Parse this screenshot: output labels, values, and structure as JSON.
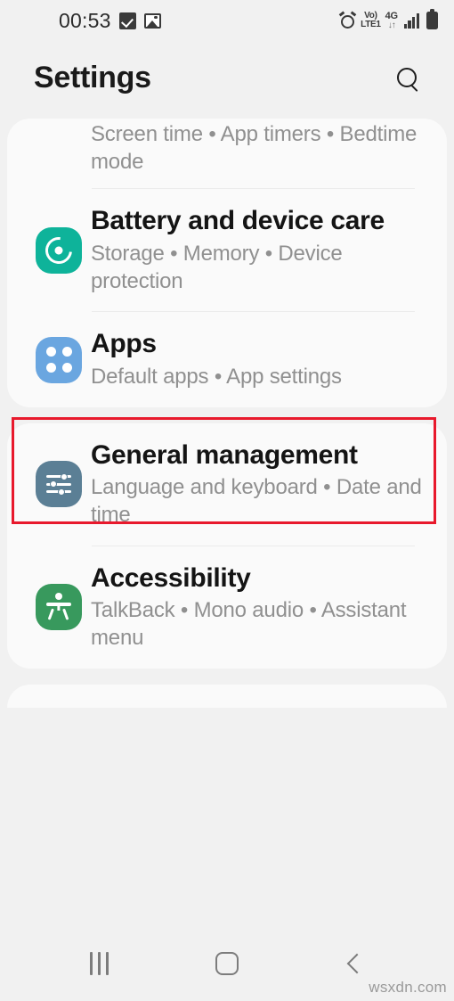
{
  "status_bar": {
    "time": "00:53",
    "left_icons": [
      "checkbox-filled-icon",
      "image-icon"
    ],
    "right_icons": [
      "alarm-icon",
      "volte-icon",
      "network-4g-icon",
      "signal-icon",
      "battery-icon"
    ],
    "volte_top": "Vo)",
    "volte_bottom": "LTE1",
    "network_type": "4G",
    "network_data_arrows": "↓↑"
  },
  "header": {
    "title": "Settings",
    "search_icon": "search-icon"
  },
  "cards": [
    {
      "id": "card-1",
      "rows": [
        {
          "id": "digital-wellbeing",
          "clipped": true,
          "title": "",
          "subtitle": "Screen time • App timers • Bedtime mode",
          "icon": "digital-wellbeing-icon",
          "icon_color": "#5e93c7",
          "highlighted": false
        },
        {
          "id": "battery-and-device-care",
          "clipped": false,
          "title": "Battery and device care",
          "subtitle": "Storage • Memory • Device protection",
          "icon": "battery-care-icon",
          "icon_color": "#0eb39a",
          "highlighted": false
        },
        {
          "id": "apps",
          "clipped": false,
          "title": "Apps",
          "subtitle": "Default apps • App settings",
          "icon": "apps-grid-icon",
          "icon_color": "#6aa6e0",
          "highlighted": true
        }
      ]
    },
    {
      "id": "card-2",
      "rows": [
        {
          "id": "general-management",
          "clipped": false,
          "title": "General management",
          "subtitle": "Language and keyboard • Date and time",
          "icon": "sliders-icon",
          "icon_color": "#5b7f95",
          "highlighted": false
        },
        {
          "id": "accessibility",
          "clipped": false,
          "title": "Accessibility",
          "subtitle": "TalkBack • Mono audio • Assistant menu",
          "icon": "accessibility-person-icon",
          "icon_color": "#38995d",
          "highlighted": false
        }
      ]
    }
  ],
  "highlight": {
    "target": "apps",
    "color": "#e8192c"
  },
  "nav_bar": {
    "recents_label": "recents-icon",
    "home_label": "home-icon",
    "back_label": "back-icon"
  },
  "watermark": "wsxdn.com"
}
